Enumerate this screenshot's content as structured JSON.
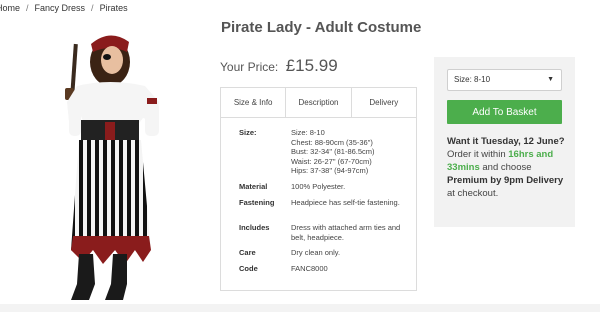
{
  "breadcrumb": {
    "items": [
      "Home",
      "Fancy Dress",
      "Pirates"
    ],
    "separator": "/"
  },
  "product": {
    "title": "Pirate Lady - Adult Costume",
    "price_label": "Your Price:",
    "price": "£15.99"
  },
  "tabs": [
    {
      "label": "Size & Info"
    },
    {
      "label": "Description"
    },
    {
      "label": "Delivery"
    }
  ],
  "specs": {
    "size": {
      "label": "Size:",
      "lines": [
        "Size: 8-10",
        "Chest: 88-90cm (35-36\")",
        "Bust: 32-34\" (81-86.5cm)",
        "Waist: 26-27\" (67-70cm)",
        "Hips: 37-38\" (94-97cm)"
      ]
    },
    "material": {
      "label": "Material",
      "value": "100% Polyester."
    },
    "fastening": {
      "label": "Fastening",
      "value": "Headpiece has self-tie fastening."
    },
    "includes": {
      "label": "Includes",
      "value": "Dress with attached arm ties and belt, headpiece."
    },
    "care": {
      "label": "Care",
      "value": "Dry clean only."
    },
    "code": {
      "label": "Code",
      "value": "FANC8000"
    }
  },
  "purchase": {
    "size_selected": "Size: 8-10",
    "add_to_basket": "Add To Basket",
    "delivery_heading": "Want it Tuesday, 12 June?",
    "order_within_prefix": "Order it within",
    "time_left": "16hrs and 33mins",
    "choose_text": "and choose",
    "premium": "Premium by 9pm Delivery",
    "checkout_text": "at checkout."
  },
  "colors": {
    "accent_green": "#4cae4c",
    "panel_bg": "#f2f2f2"
  }
}
